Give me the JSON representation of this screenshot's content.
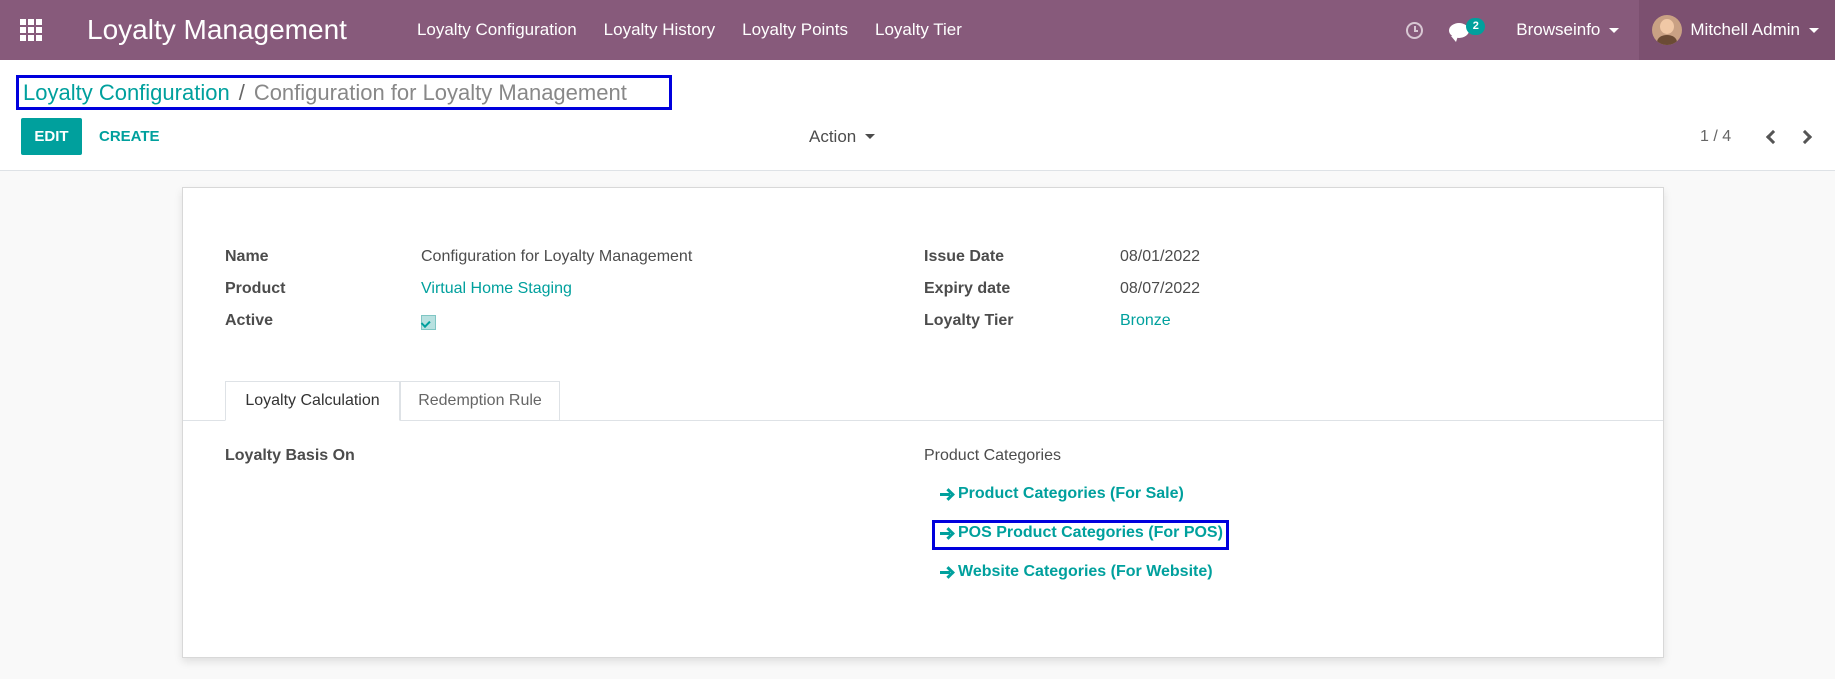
{
  "navbar": {
    "app_title": "Loyalty Management",
    "menu": [
      "Loyalty Configuration",
      "Loyalty History",
      "Loyalty Points",
      "Loyalty Tier"
    ],
    "message_count": "2",
    "company": "Browseinfo",
    "user": "Mitchell Admin",
    "colors": {
      "navbar": "#875a7b",
      "accent": "#00a09d"
    }
  },
  "breadcrumb": {
    "parent": "Loyalty Configuration",
    "separator": "/",
    "current": "Configuration for Loyalty Management"
  },
  "toolbar": {
    "edit_label": "EDIT",
    "create_label": "CREATE",
    "action_label": "Action",
    "pager": "1 / 4"
  },
  "form": {
    "left_fields": [
      {
        "label": "Name",
        "value": "Configuration for Loyalty Management"
      },
      {
        "label": "Product",
        "value": "Virtual Home Staging"
      },
      {
        "label": "Active",
        "checked": true
      }
    ],
    "right_fields": [
      {
        "label": "Issue Date",
        "value": "08/01/2022"
      },
      {
        "label": "Expiry date",
        "value": "08/07/2022"
      },
      {
        "label": "Loyalty Tier",
        "value": "Bronze"
      }
    ],
    "tabs": [
      "Loyalty Calculation",
      "Redemption Rule"
    ],
    "active_tab": "Loyalty Calculation",
    "basis_label": "Loyalty Basis On",
    "basis_value": "Product Categories",
    "category_links": [
      "Product Categories (For Sale)",
      "POS Product Categories (For POS)",
      "Website Categories (For Website)"
    ]
  }
}
